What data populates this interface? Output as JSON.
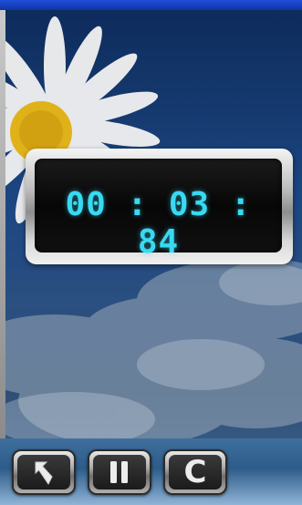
{
  "timer": {
    "display": "00 : 03 : 84"
  },
  "toolbar": {
    "back_icon": "back-arrow-icon",
    "pause_icon": "pause-icon",
    "clear_label": "C"
  },
  "colors": {
    "digits": "#38d9f2",
    "top_bar": "#1f4fd8",
    "sky": "#1c4683"
  }
}
